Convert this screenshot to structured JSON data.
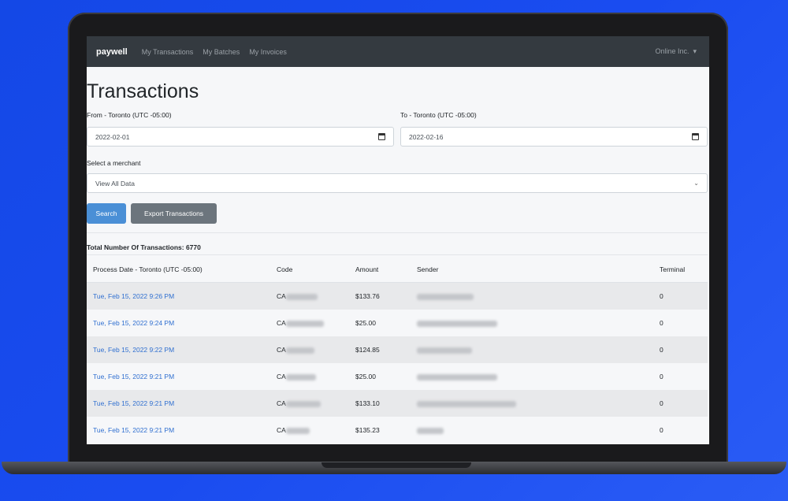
{
  "nav": {
    "brand": "paywell",
    "links": [
      "My Transactions",
      "My Batches",
      "My Invoices"
    ],
    "account": "Online Inc."
  },
  "page": {
    "title": "Transactions"
  },
  "filters": {
    "from_label": "From - Toronto (UTC -05:00)",
    "from_value": "2022-02-01",
    "to_label": "To - Toronto (UTC -05:00)",
    "to_value": "2022-02-16",
    "merchant_label": "Select a merchant",
    "merchant_value": "View All Data"
  },
  "actions": {
    "search": "Search",
    "export": "Export Transactions"
  },
  "summary": {
    "total": "Total Number Of Transactions: 6770"
  },
  "table": {
    "headers": [
      "Process Date - Toronto (UTC -05:00)",
      "Code",
      "Amount",
      "Sender",
      "Terminal"
    ],
    "rows": [
      {
        "date": "Tue, Feb 15, 2022 9:26 PM",
        "code": "CA",
        "amount": "$133.76",
        "terminal": "0"
      },
      {
        "date": "Tue, Feb 15, 2022 9:24 PM",
        "code": "CA",
        "amount": "$25.00",
        "terminal": "0"
      },
      {
        "date": "Tue, Feb 15, 2022 9:22 PM",
        "code": "CA",
        "amount": "$124.85",
        "terminal": "0"
      },
      {
        "date": "Tue, Feb 15, 2022 9:21 PM",
        "code": "CA",
        "amount": "$25.00",
        "terminal": "0"
      },
      {
        "date": "Tue, Feb 15, 2022 9:21 PM",
        "code": "CA",
        "amount": "$133.10",
        "terminal": "0"
      },
      {
        "date": "Tue, Feb 15, 2022 9:21 PM",
        "code": "CA",
        "amount": "$135.23",
        "terminal": "0"
      }
    ]
  },
  "colors": {
    "navbar": "#343a40",
    "link": "#2f6fd0",
    "primary": "#4a8fd6",
    "secondary": "#6c757d",
    "background": "#1448e6"
  }
}
